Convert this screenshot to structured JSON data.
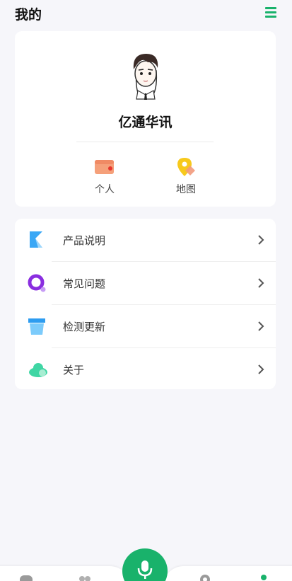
{
  "header": {
    "title": "我的",
    "menu_icon": "hamburger-menu-icon",
    "accent_color": "#19b26b"
  },
  "profile": {
    "name": "亿通华讯",
    "avatar_icon": "cartoon-avatar",
    "shortcuts": [
      {
        "label": "个人",
        "icon": "wallet-icon"
      },
      {
        "label": "地图",
        "icon": "map-pin-icon"
      }
    ]
  },
  "menu": {
    "items": [
      {
        "label": "产品说明",
        "icon": "bookmark-icon"
      },
      {
        "label": "常见问题",
        "icon": "question-search-icon"
      },
      {
        "label": "检测更新",
        "icon": "update-box-icon"
      },
      {
        "label": "关于",
        "icon": "cloud-icon"
      }
    ],
    "chevron_icon": "chevron-right-icon"
  },
  "tabbar": {
    "center_icon": "microphone-icon",
    "active_color": "#19b26b"
  }
}
